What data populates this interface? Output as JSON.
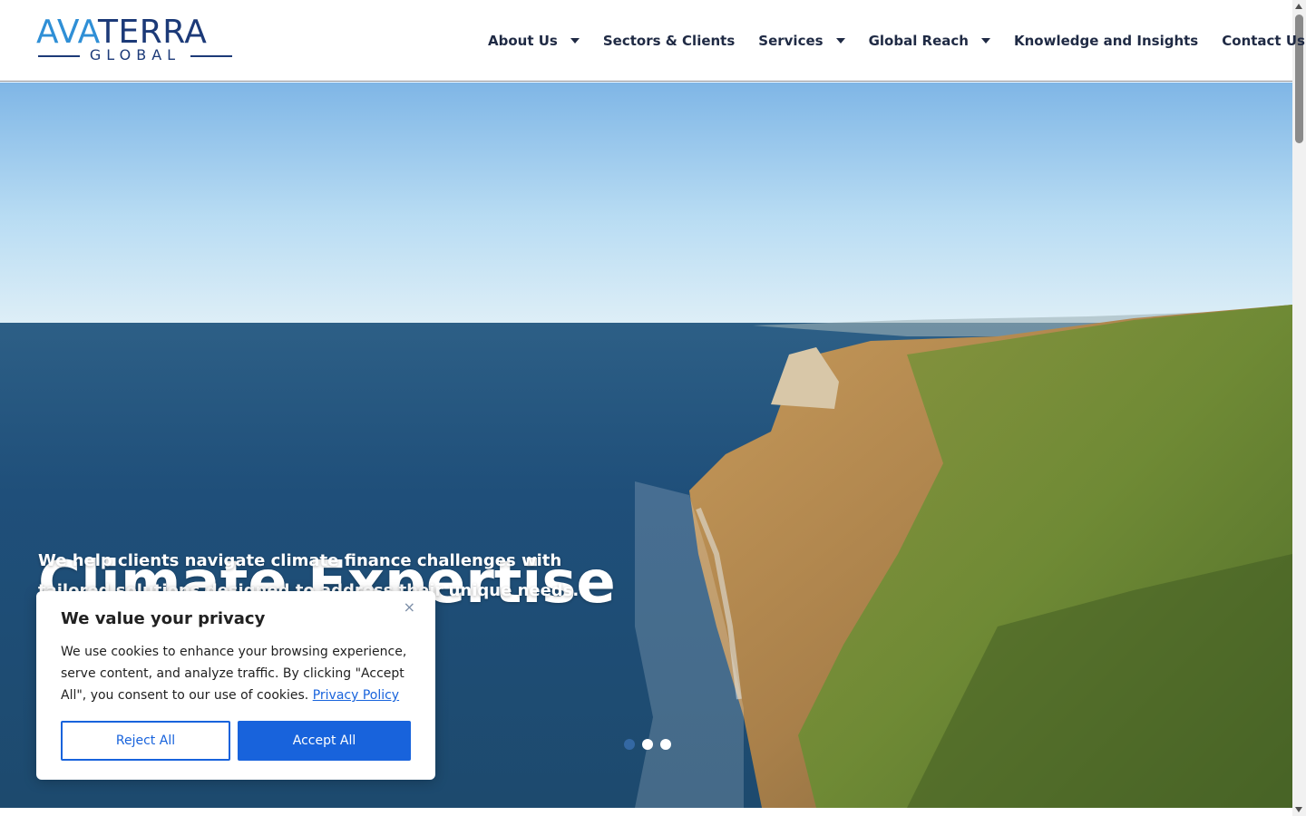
{
  "logo": {
    "part1": "AVA",
    "part2": "TERRA",
    "sub": "GLOBAL"
  },
  "nav": {
    "items": [
      {
        "label": "About Us",
        "has_dropdown": true
      },
      {
        "label": "Sectors & Clients",
        "has_dropdown": false
      },
      {
        "label": "Services",
        "has_dropdown": true
      },
      {
        "label": "Global Reach",
        "has_dropdown": true
      },
      {
        "label": "Knowledge and Insights",
        "has_dropdown": false
      },
      {
        "label": "Contact Us",
        "has_dropdown": false
      }
    ]
  },
  "hero": {
    "title": "Climate Expertise",
    "subtitle": "We help clients navigate climate finance challenges with tailored solutions designed to address their unique needs.",
    "slides": 3,
    "active_slide": 1
  },
  "cookie": {
    "title": "We value your privacy",
    "text": "We use cookies to enhance your browsing experience, serve content, and analyze traffic. By clicking \"Accept All\", you consent to our use of cookies.",
    "link": "Privacy Policy",
    "reject_label": "Reject All",
    "accept_label": "Accept All",
    "close_label": "×"
  },
  "colors": {
    "brand_light": "#2f8fd6",
    "brand_dark": "#1c3a78",
    "nav_text": "#1f2a44",
    "cookie_accent": "#1863dc"
  }
}
